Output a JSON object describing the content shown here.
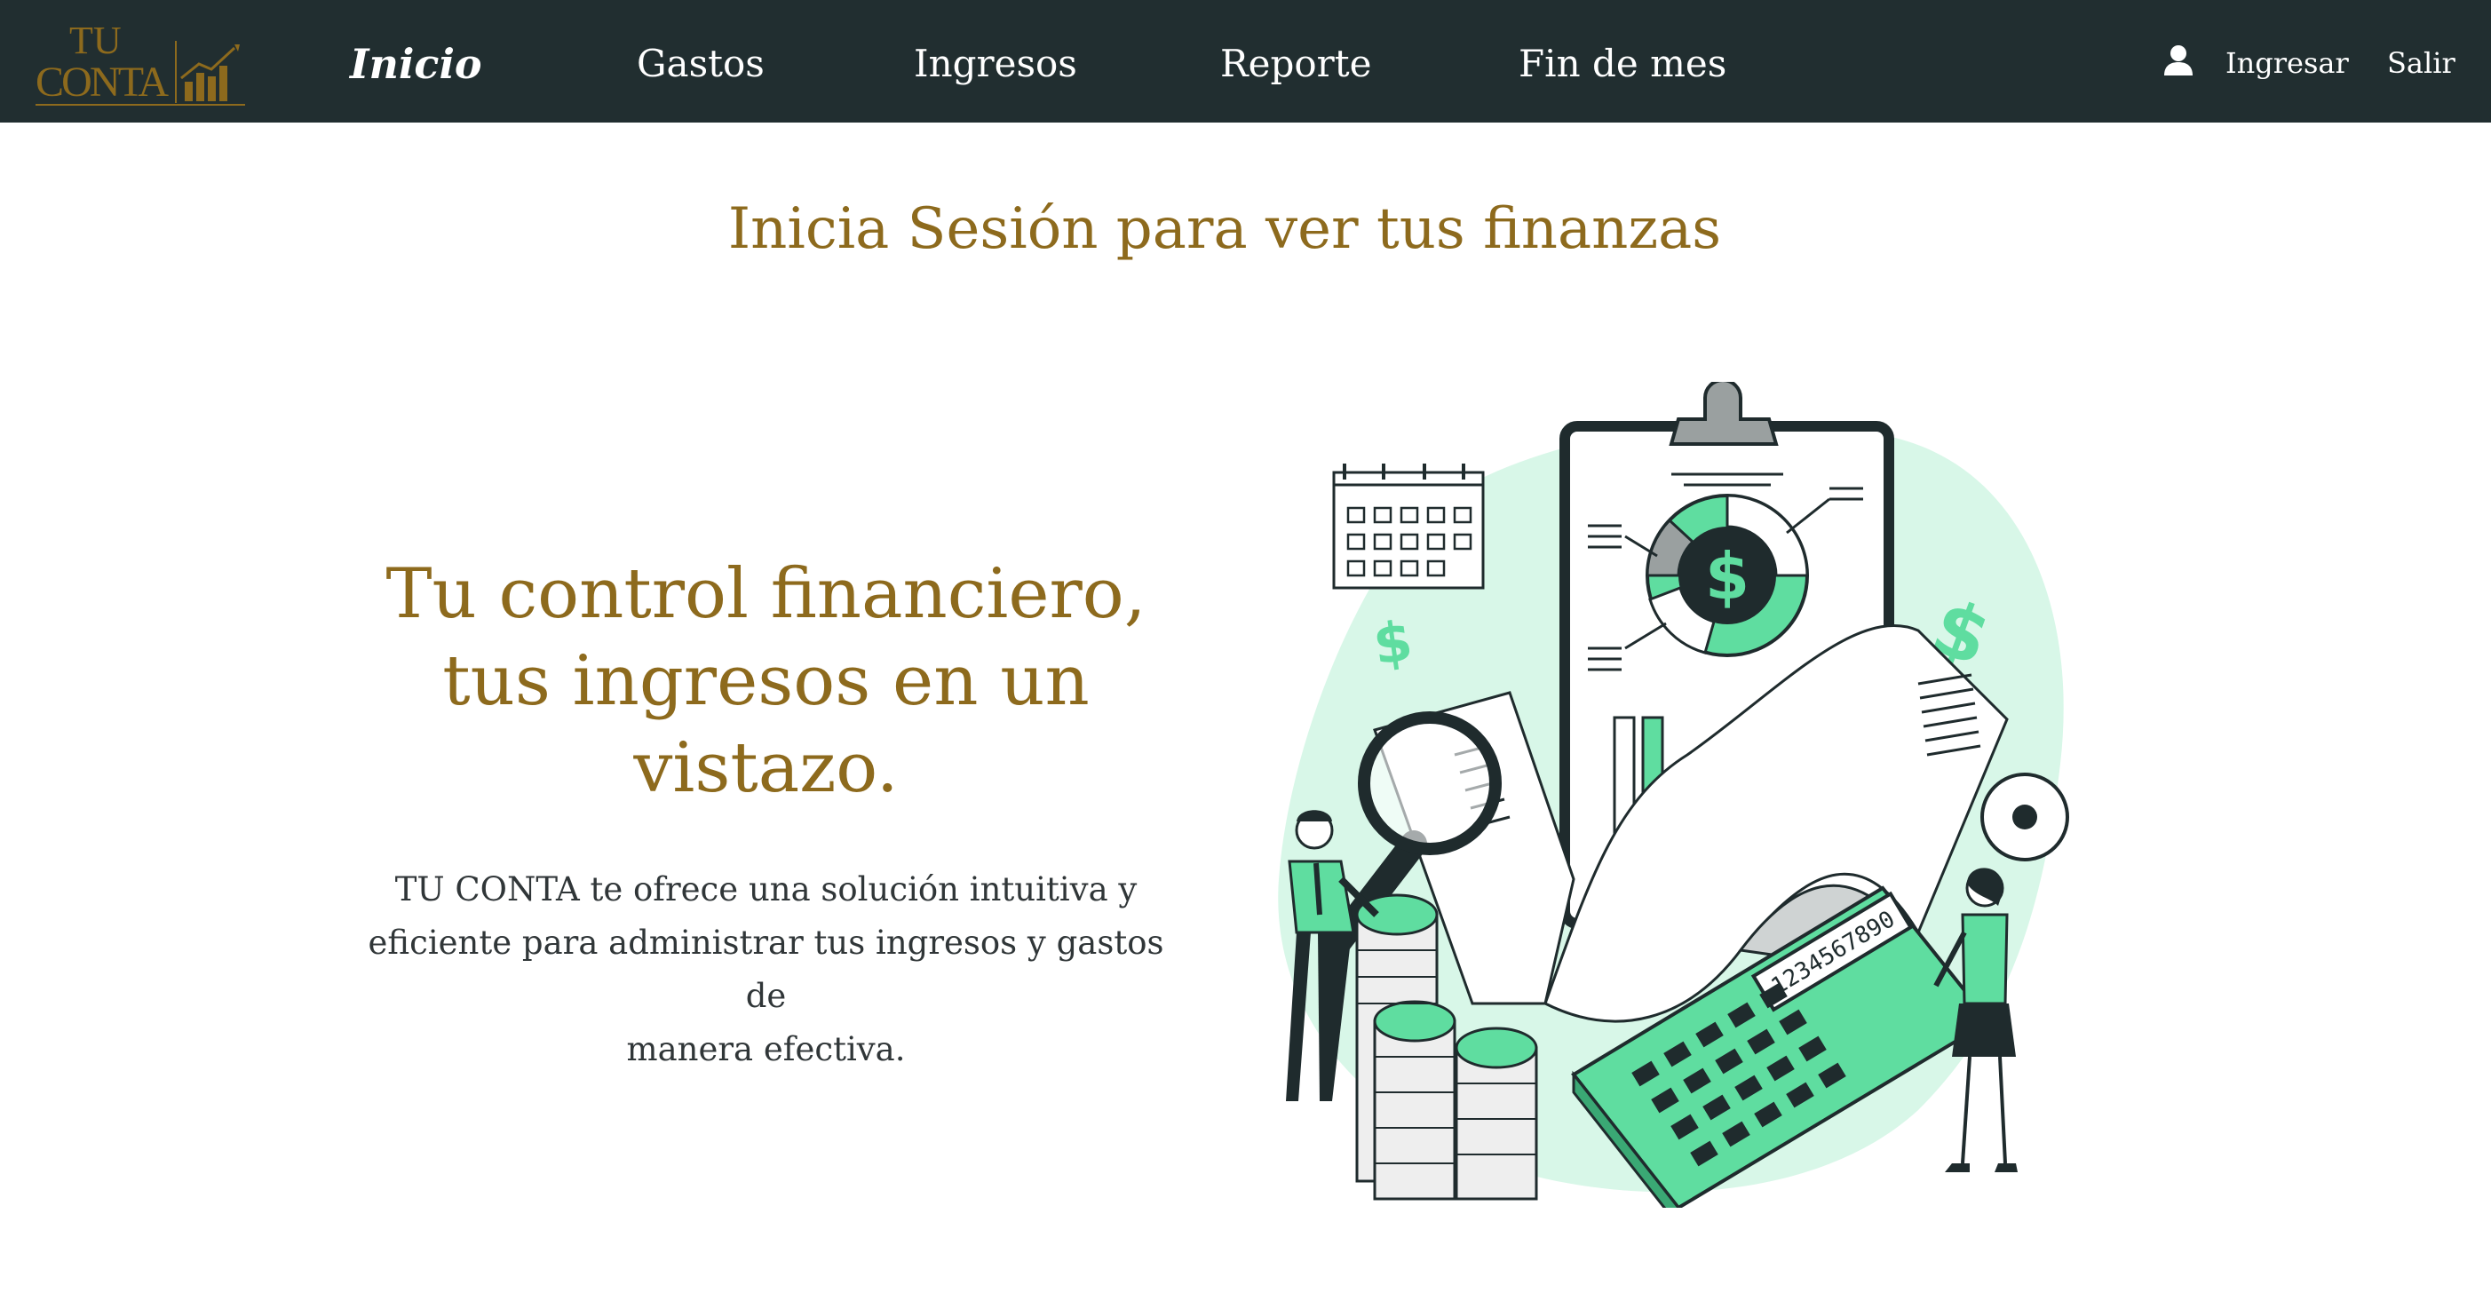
{
  "brand": {
    "logo_line1": "TU",
    "logo_line2": "CONTA",
    "color": "#8d6a1d"
  },
  "nav": {
    "items": [
      {
        "label": "Inicio",
        "active": true
      },
      {
        "label": "Gastos",
        "active": false
      },
      {
        "label": "Ingresos",
        "active": false
      },
      {
        "label": "Reporte",
        "active": false
      },
      {
        "label": "Fin de mes",
        "active": false
      }
    ],
    "user_icon": "user-icon",
    "login_label": "Ingresar",
    "logout_label": "Salir",
    "background": "#212e30"
  },
  "page": {
    "title": "Inicia Sesión para ver tus finanzas"
  },
  "hero": {
    "heading_line1": "Tu control financiero,",
    "heading_line2": "tus ingresos en un",
    "heading_line3": "vistazo.",
    "text_line1": "TU CONTA te ofrece una solución intuitiva y",
    "text_line2": "eficiente para administrar tus ingresos y gastos de",
    "text_line3": "manera efectiva."
  },
  "illustration": {
    "calculator_display": "1234567890",
    "dollar_sign": "$",
    "accent": "#5fdda0",
    "dark": "#1f2b2d",
    "blob": "#d8f7e8"
  }
}
